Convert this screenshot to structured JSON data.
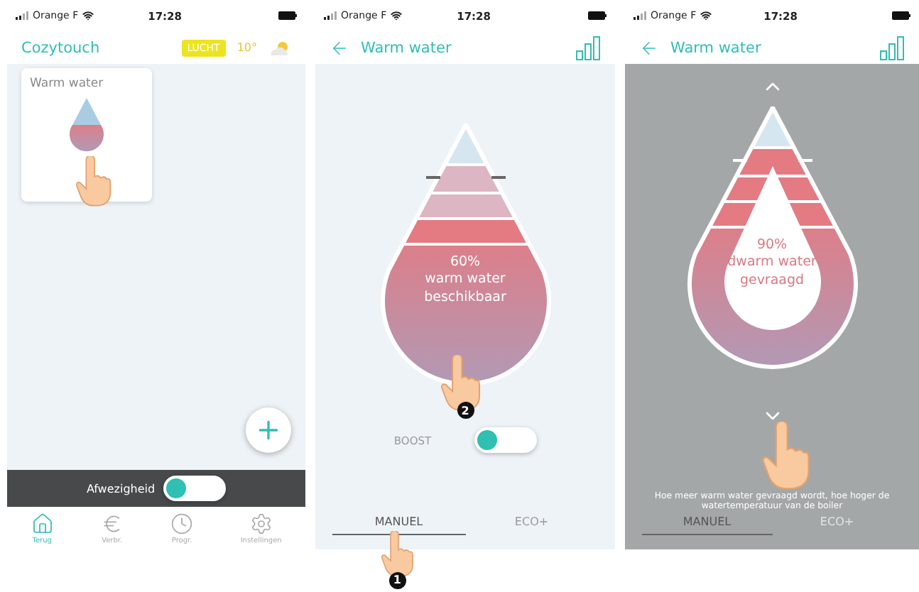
{
  "screens": [
    {
      "kind": "home",
      "status_bar": {
        "carrier": "Orange F",
        "time": "17:28"
      },
      "header": {
        "title": "Cozytouch",
        "air_badge": "LUCHT",
        "temperature": "10°"
      },
      "card": {
        "title": "Warm water"
      },
      "absence": {
        "label": "Afwezigheid",
        "on": false
      },
      "nav": [
        {
          "label": "Terug",
          "selected": true
        },
        {
          "label": "Verbr.",
          "selected": false
        },
        {
          "label": "Progr.",
          "selected": false
        },
        {
          "label": "Instellingen",
          "selected": false
        }
      ]
    },
    {
      "kind": "available",
      "status_bar": {
        "carrier": "Orange F",
        "time": "17:28"
      },
      "header": {
        "title": "Warm water"
      },
      "drop": {
        "bands": [
          {
            "filled": false
          },
          {
            "filled": false
          },
          {
            "filled": true
          }
        ],
        "lines": [
          "60%",
          "warm water",
          "beschikbaar"
        ]
      },
      "step_marker": "2",
      "boost": {
        "label": "BOOST",
        "on": false
      },
      "modes": [
        {
          "label": "MANUEL",
          "selected": true
        },
        {
          "label": "ECO+",
          "selected": false
        }
      ],
      "tab_marker": "1"
    },
    {
      "kind": "request",
      "status_bar": {
        "carrier": "Orange F",
        "time": "17:28"
      },
      "header": {
        "title": "Warm water"
      },
      "drop": {
        "bands": [
          {
            "filled": true
          },
          {
            "filled": true
          },
          {
            "filled": true
          }
        ],
        "lines": [
          "90%",
          "dwarm water",
          "gevraagd"
        ]
      },
      "hint": "Hoe meer warm water gevraagd wordt, hoe hoger de watertemperatuur van de boiler",
      "modes": [
        {
          "label": "MANUEL",
          "selected": true
        },
        {
          "label": "ECO+",
          "selected": false
        }
      ]
    }
  ]
}
